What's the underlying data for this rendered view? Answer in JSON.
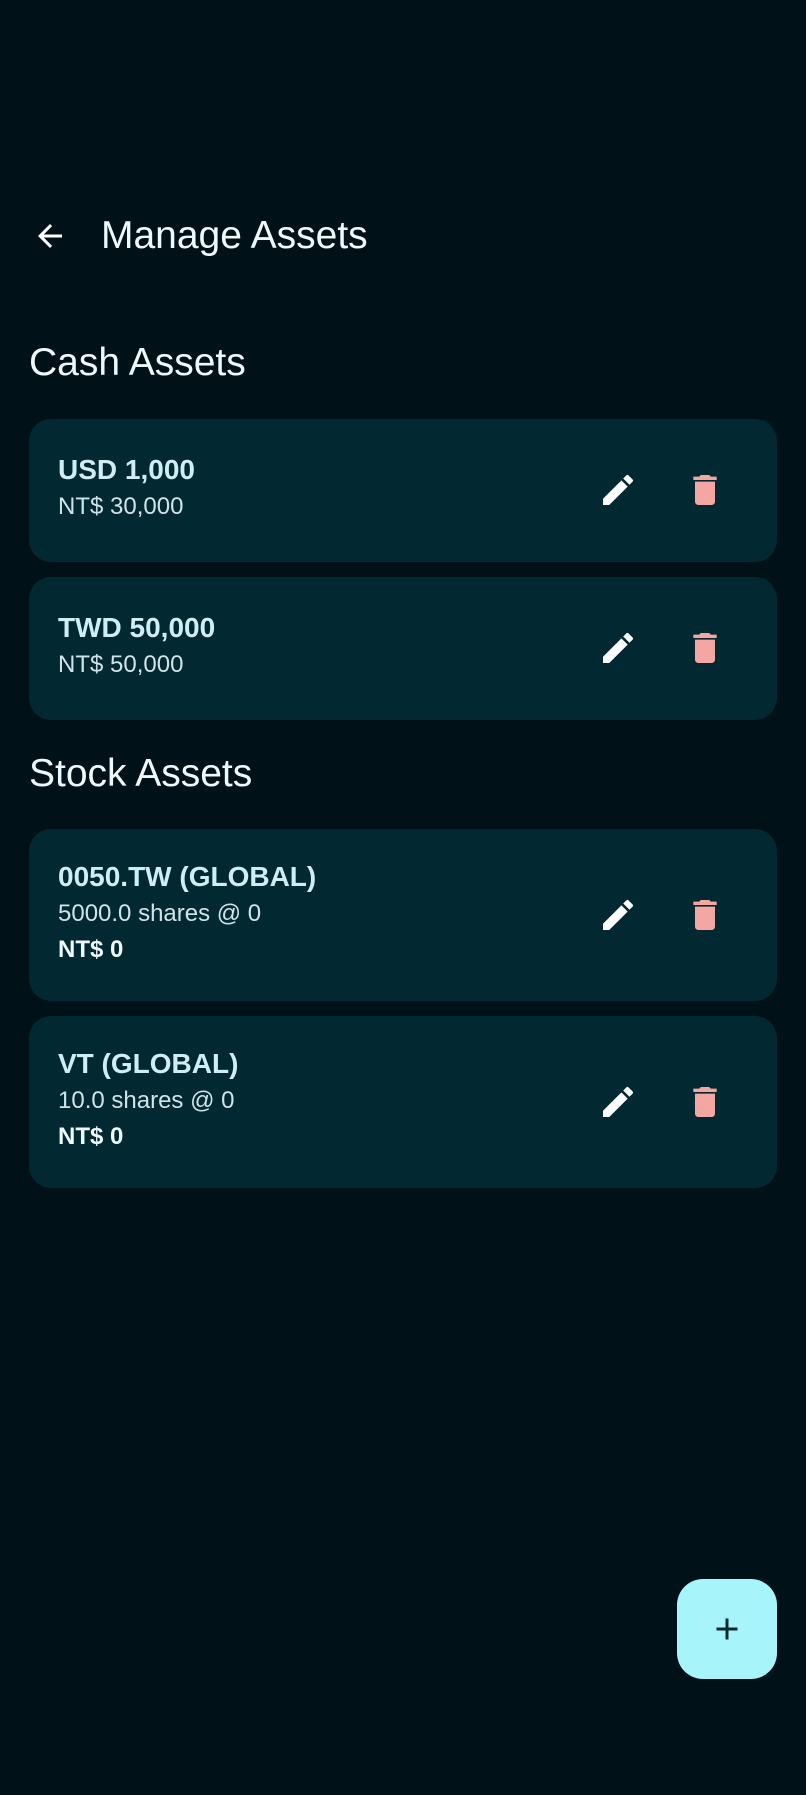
{
  "header": {
    "title": "Manage Assets",
    "back_icon": "arrow-left-icon"
  },
  "cash_section": {
    "title": "Cash Assets",
    "items": [
      {
        "name": "USD 1,000",
        "converted": "NT$ 30,000"
      },
      {
        "name": "TWD 50,000",
        "converted": "NT$ 50,000"
      }
    ]
  },
  "stock_section": {
    "title": "Stock Assets",
    "items": [
      {
        "name": "0050.TW (GLOBAL)",
        "shares": "5000.0 shares @ 0",
        "value": "NT$ 0"
      },
      {
        "name": "VT (GLOBAL)",
        "shares": "10.0 shares @ 0",
        "value": "NT$ 0"
      }
    ]
  },
  "icons": {
    "edit": "pencil-icon",
    "delete": "trash-icon",
    "add": "plus-icon"
  },
  "colors": {
    "background": "#001117",
    "card": "#022831",
    "edit_icon": "#ffffff",
    "delete_icon": "#f4a6a3",
    "fab_background": "#a7f5fb",
    "fab_icon": "#0b2a30"
  }
}
